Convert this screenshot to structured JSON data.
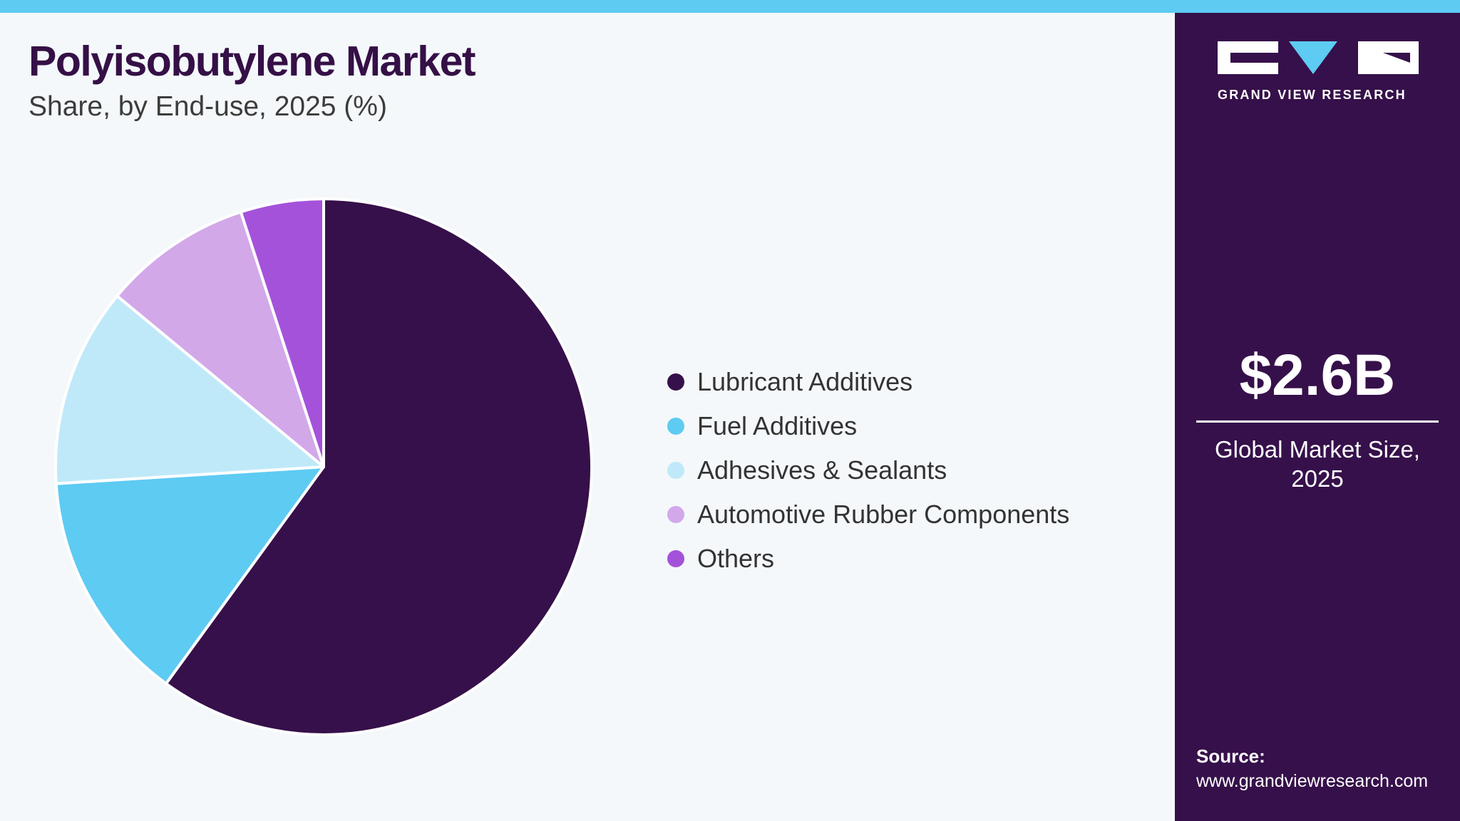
{
  "header": {
    "title": "Polyisobutylene Market",
    "subtitle": "Share, by End-use, 2025 (%)"
  },
  "colors": {
    "accent_bar": "#5ecbf3",
    "panel": "#36104a",
    "title": "#351046"
  },
  "chart_data": {
    "type": "pie",
    "title": "Polyisobutylene Market",
    "subtitle": "Share, by End-use, 2025 (%)",
    "legend_position": "right",
    "slices": [
      {
        "label": "Lubricant Additives",
        "value": 60,
        "color": "#36104a"
      },
      {
        "label": "Fuel Additives",
        "value": 14,
        "color": "#5ecbf3"
      },
      {
        "label": "Adhesives & Sealants",
        "value": 12,
        "color": "#bfe9f9"
      },
      {
        "label": "Automotive Rubber Components",
        "value": 9,
        "color": "#d2a8e9"
      },
      {
        "label": "Others",
        "value": 5,
        "color": "#a552db"
      }
    ]
  },
  "side_panel": {
    "logo_text": "GRAND VIEW RESEARCH",
    "market_size": "$2.6B",
    "market_caption": "Global Market Size, 2025",
    "source_label": "Source:",
    "source_url": "www.grandviewresearch.com"
  }
}
